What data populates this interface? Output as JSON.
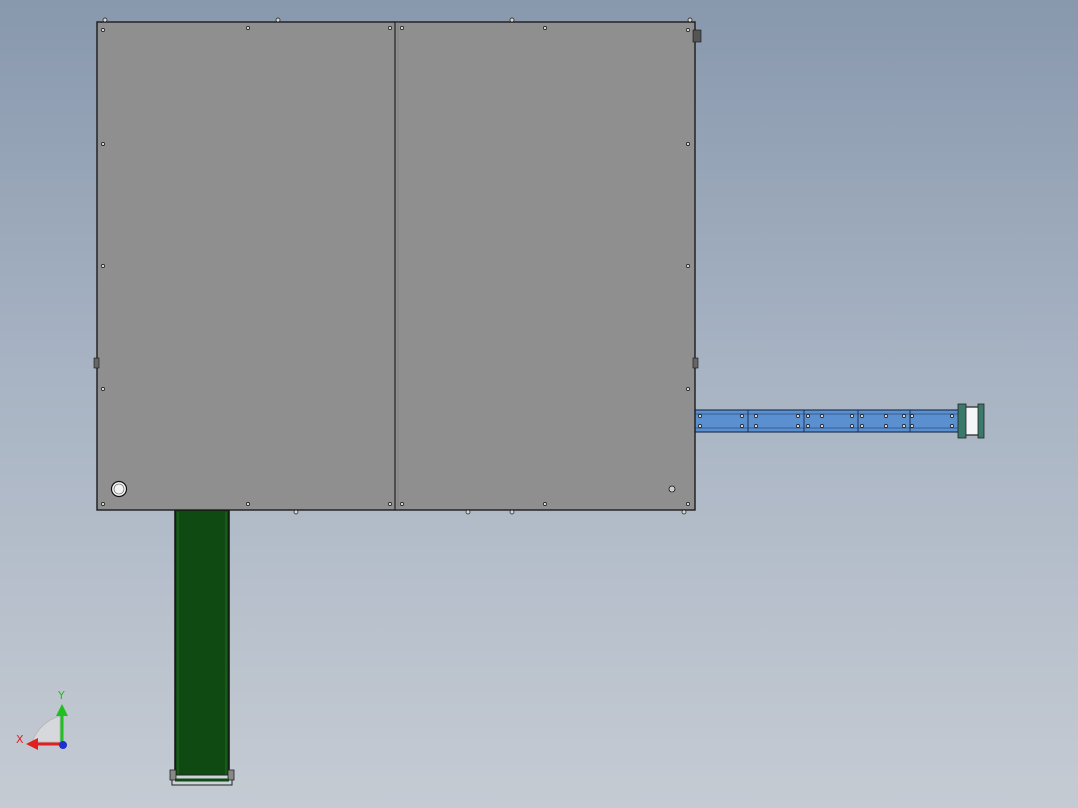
{
  "viewport": {
    "background_top": "#8898ad",
    "background_bottom": "#c5cbd3"
  },
  "model": {
    "enclosure": {
      "name": "main-enclosure",
      "color": "#8f8f8f"
    },
    "right_conveyor": {
      "name": "side-conveyor",
      "color": "#5a8fd0"
    },
    "bottom_conveyor": {
      "name": "outfeed-conveyor",
      "color": "#0f4a12"
    }
  },
  "triad": {
    "x_label": "X",
    "y_label": "Y",
    "x_color": "#e02020",
    "y_color": "#1fc01f",
    "z_color": "#2030d0"
  }
}
